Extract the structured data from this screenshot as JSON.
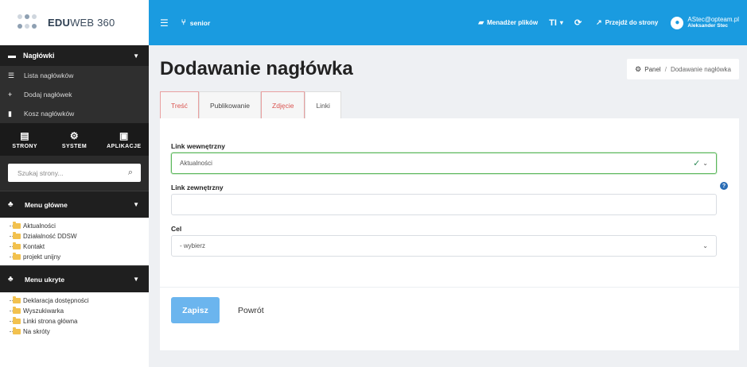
{
  "logo": {
    "bold": "EDU",
    "rest": "WEB 360"
  },
  "sidebar": {
    "section_title": "Nagłówki",
    "links": [
      {
        "label": "Lista nagłówków",
        "icon": "list-icon"
      },
      {
        "label": "Dodaj nagłówek",
        "icon": "plus-icon"
      },
      {
        "label": "Kosz nagłówków",
        "icon": "trash-icon"
      }
    ],
    "tabs": [
      {
        "label": "STRONY",
        "icon": "file-icon"
      },
      {
        "label": "SYSTEM",
        "icon": "gear-icon"
      },
      {
        "label": "APLIKACJE",
        "icon": "apps-icon"
      }
    ],
    "search_placeholder": "Szukaj strony...",
    "menu_main": {
      "title": "Menu główne",
      "items": [
        "Aktualności",
        "Działalność DDSW",
        "Kontakt",
        "projekt unijny"
      ]
    },
    "menu_hidden": {
      "title": "Menu ukryte",
      "items": [
        "Deklaracja dostępności",
        "Wyszukiwarka",
        "Linki strona główna",
        "Na skróty"
      ]
    }
  },
  "topbar": {
    "site": "senior",
    "file_manager": "Menadżer plików",
    "text_size": "TI",
    "goto_site": "Przejdź do strony",
    "user_email": "AStec@opteam.pl",
    "user_name": "Aleksander Stec"
  },
  "page": {
    "title": "Dodawanie nagłówka",
    "breadcrumb": {
      "home": "Panel",
      "current": "Dodawanie nagłówka"
    },
    "tabs": [
      {
        "label": "Treść",
        "state": "error"
      },
      {
        "label": "Publikowanie",
        "state": "normal"
      },
      {
        "label": "Zdjęcie",
        "state": "error"
      },
      {
        "label": "Linki",
        "state": "active"
      }
    ],
    "form": {
      "internal_link_label": "Link wewnętrzny",
      "internal_link_value": "Aktualności",
      "external_link_label": "Link zewnętrzny",
      "external_link_value": "",
      "target_label": "Cel",
      "target_value": "- wybierz"
    },
    "save_label": "Zapisz",
    "back_label": "Powrót"
  },
  "colors": {
    "accent": "#1a9be0",
    "save": "#6bb5ee",
    "error": "#d9534f",
    "valid": "#5cb85c"
  }
}
